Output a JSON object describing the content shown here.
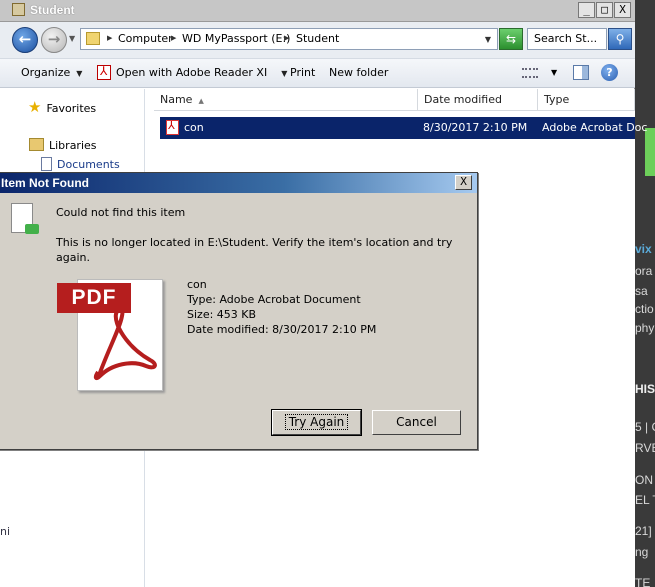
{
  "background_window": {
    "fragments": [
      "vix",
      "ora",
      "sa",
      "ctio",
      "phy",
      "HIS",
      "5 | C",
      "RVE",
      "ON",
      "EL T",
      "21]",
      "ng",
      "TE"
    ]
  },
  "explorer": {
    "title": "Student",
    "window_buttons": {
      "minimize": "_",
      "maximize": "□",
      "close": "X"
    },
    "breadcrumbs": [
      "Computer",
      "WD MyPassport (E:)",
      "Student"
    ],
    "search_placeholder": "Search St...",
    "toolbar": {
      "organize": "Organize",
      "open_with": "Open with Adobe Reader XI",
      "print": "Print",
      "new_folder": "New folder"
    },
    "nav": {
      "favorites": "Favorites",
      "libraries": "Libraries",
      "documents": "Documents"
    },
    "columns": [
      "Name",
      "Date modified",
      "Type"
    ],
    "files": [
      {
        "name": "con",
        "date_modified": "8/30/2017 2:10 PM",
        "type": "Adobe Acrobat Doc"
      }
    ],
    "nav_fragments": [
      "ni"
    ]
  },
  "dialog": {
    "title": "Item Not Found",
    "heading": "Could not find this item",
    "message_line1": "This is no longer located in E:\\Student. Verify the item's location and try",
    "message_line2": "again.",
    "file_name": "con",
    "file_type": "Type: Adobe Acrobat Document",
    "file_size": "Size: 453 KB",
    "file_date": "Date modified: 8/30/2017 2:10 PM",
    "pdf_label": "PDF",
    "try_again": "Try Again",
    "cancel": "Cancel",
    "close": "X"
  },
  "colors": {
    "selection": "#0a246a",
    "dialog_bg": "#d4d0c8",
    "pdf_red": "#b51e1e"
  }
}
